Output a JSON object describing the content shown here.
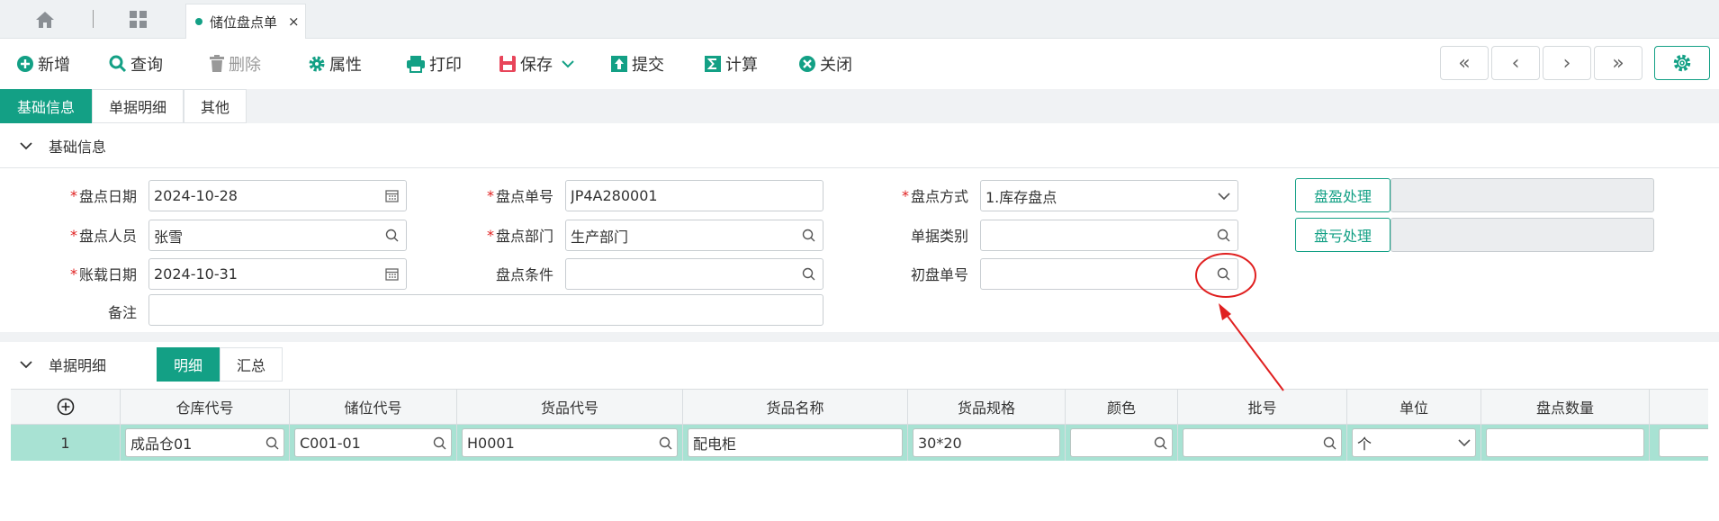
{
  "tabs": {
    "active_label": "储位盘点单",
    "close_glyph": "×"
  },
  "toolbar": {
    "add": "新增",
    "query": "查询",
    "delete": "删除",
    "props": "属性",
    "print": "打印",
    "save": "保存",
    "submit": "提交",
    "calc": "计算",
    "close": "关闭"
  },
  "nav": {
    "first": "«",
    "prev": "‹",
    "next": "›",
    "last": "»"
  },
  "section_tabs": [
    "基础信息",
    "单据明细",
    "其他"
  ],
  "basic": {
    "title": "基础信息",
    "date_label": "盘点日期",
    "date_value": "2024-10-28",
    "no_label": "盘点单号",
    "no_value": "JP4A280001",
    "method_label": "盘点方式",
    "method_value": "1.库存盘点",
    "person_label": "盘点人员",
    "person_value": "张雪",
    "dept_label": "盘点部门",
    "dept_value": "生产部门",
    "category_label": "单据类别",
    "category_value": "",
    "acc_date_label": "账载日期",
    "acc_date_value": "2024-10-31",
    "cond_label": "盘点条件",
    "cond_value": "",
    "init_no_label": "初盘单号",
    "init_no_value": "",
    "remark_label": "备注",
    "remark_value": "",
    "surplus_btn": "盘盈处理",
    "loss_btn": "盘亏处理"
  },
  "detail": {
    "title": "单据明细",
    "subtabs": [
      "明细",
      "汇总"
    ],
    "columns": [
      "仓库代号",
      "储位代号",
      "货品代号",
      "货品名称",
      "货品规格",
      "颜色",
      "批号",
      "单位",
      "盘点数量"
    ],
    "row": {
      "no": "1",
      "warehouse": "成品仓01",
      "location": "C001-01",
      "item_code": "H0001",
      "item_name": "配电柜",
      "spec": "30*20",
      "color": "",
      "batch": "",
      "unit": "个",
      "qty": ""
    }
  },
  "colors": {
    "accent": "#13a085",
    "annotation": "#e02020"
  }
}
